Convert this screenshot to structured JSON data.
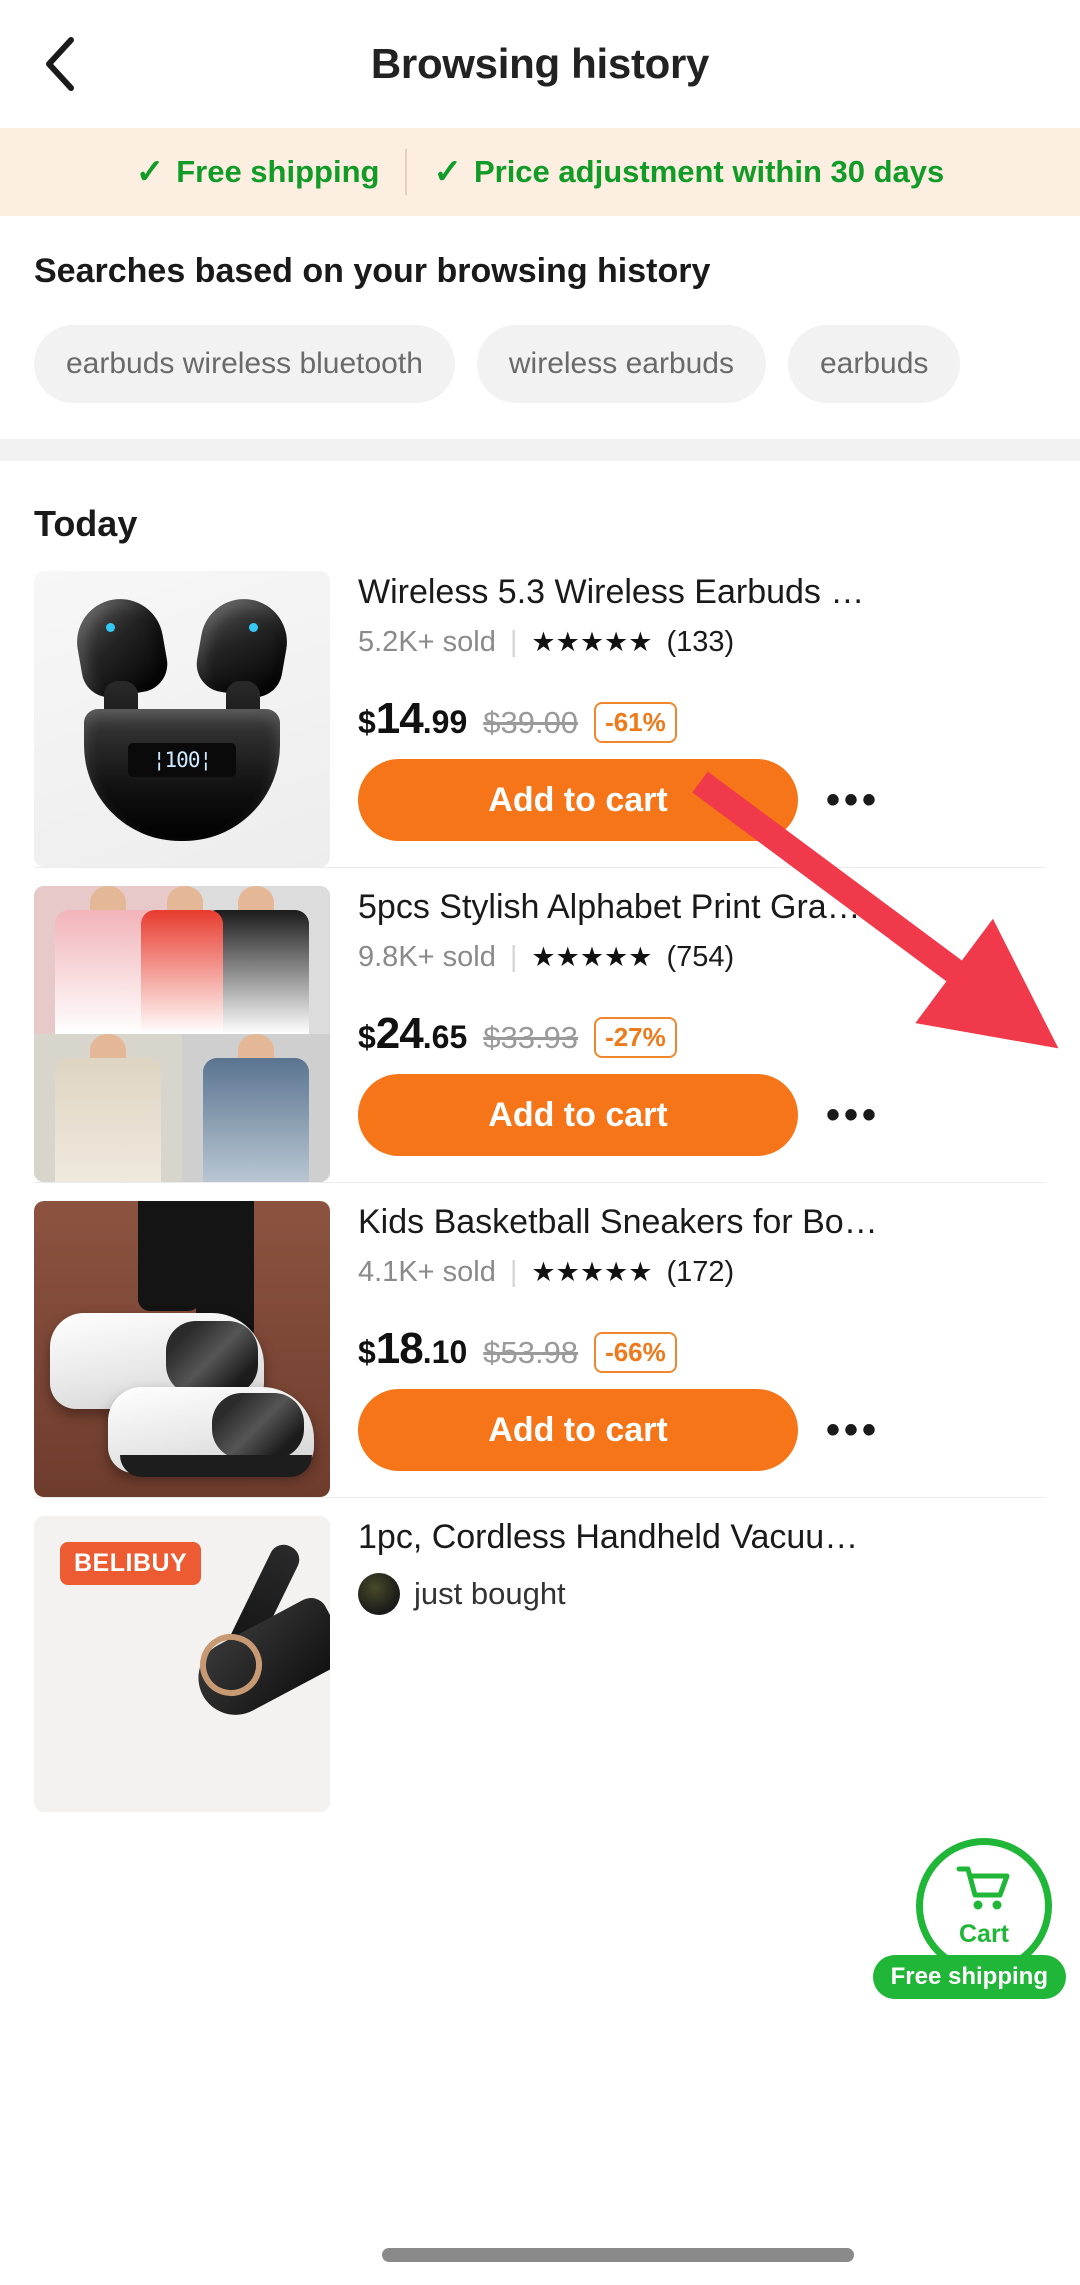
{
  "header": {
    "back_icon": "chevron-left-icon",
    "title": "Browsing history"
  },
  "promo": {
    "items": [
      {
        "icon": "check-icon",
        "label": "Free shipping"
      },
      {
        "icon": "check-icon",
        "label": "Price adjustment within 30 days"
      }
    ],
    "color": "#119B27",
    "background": "#FDEEE2"
  },
  "searches": {
    "title": "Searches based on your browsing history",
    "chips": [
      "earbuds wireless bluetooth",
      "wireless earbuds",
      "earbuds"
    ]
  },
  "list": {
    "section_label": "Today",
    "add_to_cart_label": "Add to cart",
    "more_icon": "ellipsis-icon",
    "products": [
      {
        "title": "Wireless 5.3 Wireless Earbuds …",
        "sold": "5.2K+ sold",
        "stars": "★★★★★",
        "reviews": "(133)",
        "price_currency": "$",
        "price_int": "14",
        "price_dec": ".99",
        "price_old": "$39.00",
        "discount": "-61%",
        "image": "black-wireless-earbuds-charging-case"
      },
      {
        "title": "5pcs Stylish Alphabet Print Gra…",
        "sold": "9.8K+ sold",
        "stars": "★★★★★",
        "reviews": "(754)",
        "price_currency": "$",
        "price_int": "24",
        "price_dec": ".65",
        "price_old": "$33.93",
        "discount": "-27%",
        "image": "five-gradient-print-tshirts"
      },
      {
        "title": "Kids Basketball Sneakers for Bo…",
        "sold": "4.1K+ sold",
        "stars": "★★★★★",
        "reviews": "(172)",
        "price_currency": "$",
        "price_int": "18",
        "price_dec": ".10",
        "price_old": "$53.98",
        "discount": "-66%",
        "image": "white-black-camo-basketball-sneakers"
      },
      {
        "title": "1pc, Cordless Handheld Vacuu…",
        "badge": "BELIBUY",
        "just_bought": "just bought",
        "image": "cordless-handheld-vacuum"
      }
    ]
  },
  "floating": {
    "cart_icon": "shopping-cart-icon",
    "cart_label": "Cart",
    "free_shipping_label": "Free shipping",
    "accent": "#20B637"
  },
  "theme": {
    "cart_button_orange": "#F57518",
    "discount_orange": "#EE7A1C",
    "belibuy_orange": "#EC5B32",
    "arrow_red": "#F03A4B"
  }
}
